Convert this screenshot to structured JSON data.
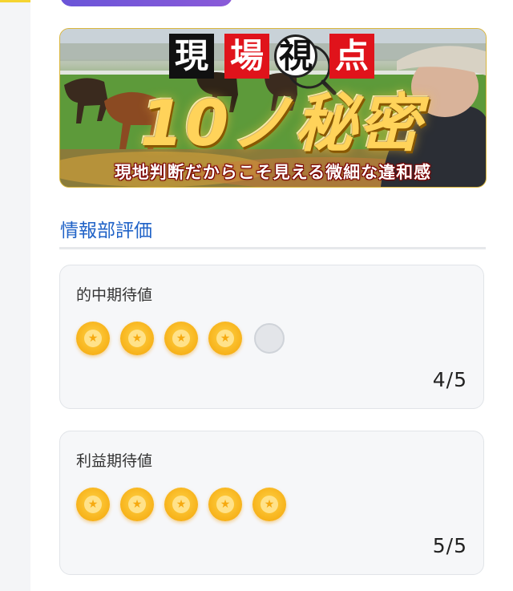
{
  "banner": {
    "kanji": [
      "現",
      "場",
      "視",
      "点"
    ],
    "title": "10ノ秘密",
    "subtitle": "現地判断だからこそ見える微細な違和感"
  },
  "section": {
    "heading": "情報部評価"
  },
  "ratings": [
    {
      "label": "的中期待値",
      "score": "4/5",
      "value": 4,
      "max": 5
    },
    {
      "label": "利益期待値",
      "score": "5/5",
      "value": 5,
      "max": 5
    }
  ],
  "colors": {
    "accent": "#1f62c7",
    "star_on": "#f7b21a",
    "star_off": "#e3e5e9",
    "top_line": "#f5d431"
  },
  "icons": {
    "star_filled": "star-filled-icon",
    "star_empty": "star-empty-icon",
    "magnifier": "magnifier-icon"
  }
}
